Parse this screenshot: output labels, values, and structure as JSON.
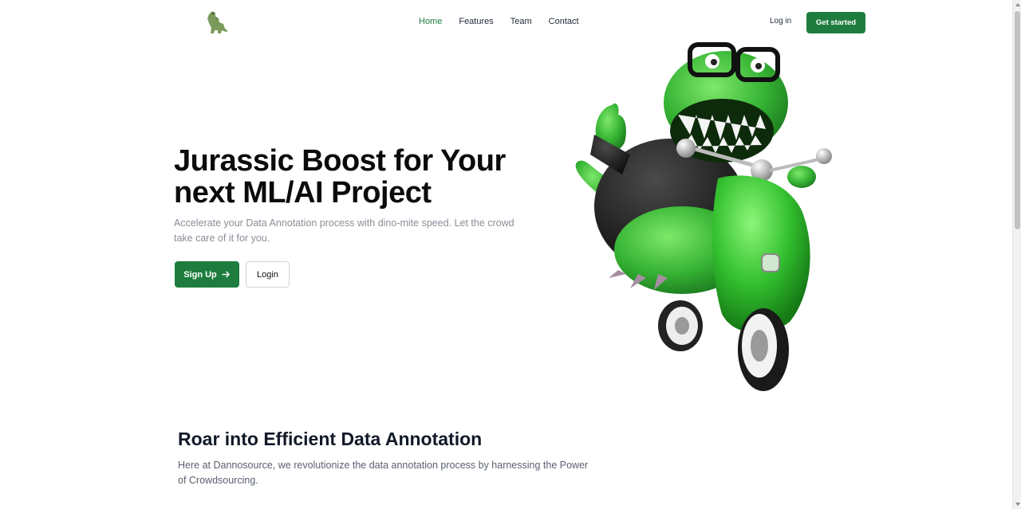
{
  "header": {
    "logo_icon": "dino-icon",
    "nav": [
      {
        "label": "Home",
        "active": true
      },
      {
        "label": "Features",
        "active": false
      },
      {
        "label": "Team",
        "active": false
      },
      {
        "label": "Contact",
        "active": false
      }
    ],
    "login_label": "Log in",
    "get_started_label": "Get started"
  },
  "hero": {
    "title_line1": "Jurassic Boost for Your",
    "title_line2": "next ML/AI Project",
    "subtitle": "Accelerate your Data Annotation process with dino-mite speed. Let the crowd take care of it for you.",
    "signup_label": "Sign Up",
    "signup_icon": "arrow-right-icon",
    "login_label": "Login",
    "illustration": "dinosaur-on-scooter-illustration"
  },
  "section": {
    "title": "Roar into Efficient Data Annotation",
    "body": "Here at Dannosource, we revolutionize the data annotation process by harnessing the Power of Crowdsourcing."
  },
  "colors": {
    "brand_green": "#1e7d3e",
    "dino_green": "#3fbf3a"
  }
}
